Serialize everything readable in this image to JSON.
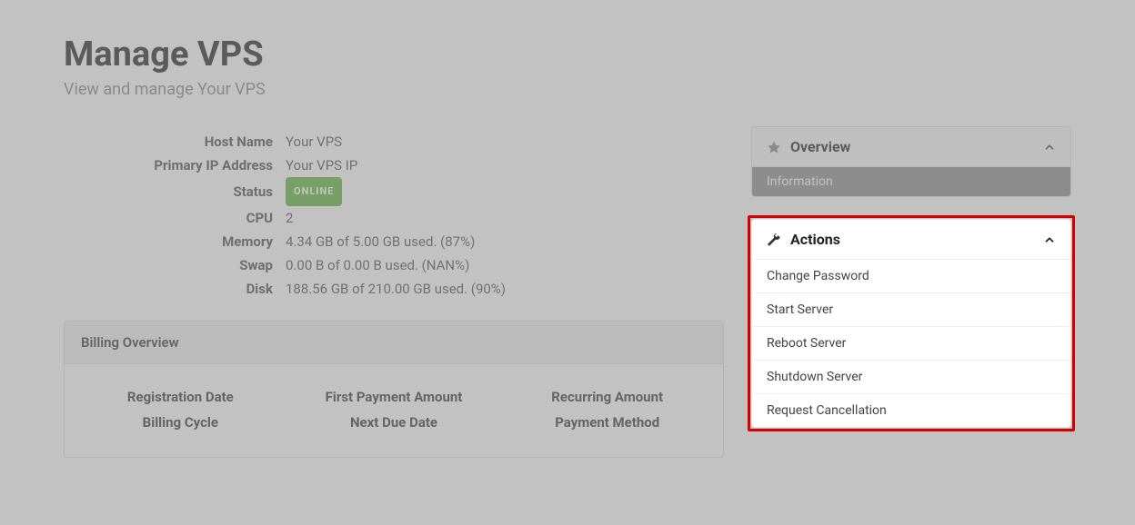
{
  "header": {
    "title": "Manage VPS",
    "subtitle": "View and manage Your VPS"
  },
  "details": {
    "host_name_label": "Host Name",
    "host_name_value": "Your VPS",
    "primary_ip_label": "Primary IP Address",
    "primary_ip_value": "Your VPS IP",
    "status_label": "Status",
    "status_value": "ONLINE",
    "cpu_label": "CPU",
    "cpu_value": "2",
    "memory_label": "Memory",
    "memory_value": "4.34 GB of 5.00 GB used. (87%)",
    "swap_label": "Swap",
    "swap_value": "0.00 B of 0.00 B used. (NAN%)",
    "disk_label": "Disk",
    "disk_value": "188.56 GB of 210.00 GB used. (90%)"
  },
  "billing": {
    "header": "Billing Overview",
    "col1a": "Registration Date",
    "col1b": "Billing Cycle",
    "col2a": "First Payment Amount",
    "col2b": "Next Due Date",
    "col3a": "Recurring Amount",
    "col3b": "Payment Method"
  },
  "overview_panel": {
    "title": "Overview",
    "subitem": "Information"
  },
  "actions_panel": {
    "title": "Actions",
    "items": [
      "Change Password",
      "Start Server",
      "Reboot Server",
      "Shutdown Server",
      "Request Cancellation"
    ]
  }
}
